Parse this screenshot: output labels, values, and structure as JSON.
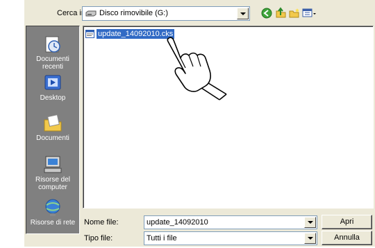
{
  "dialog": {
    "look_in": {
      "label": "Cerca in:",
      "value": "Disco rimovibile (G:)",
      "icon": "removable-drive-icon"
    },
    "toolbar": {
      "back_icon": "back-arrow-icon",
      "up_icon": "up-one-level-icon",
      "new_folder_icon": "new-folder-icon",
      "view_menu_icon": "view-menu-icon"
    },
    "places": [
      {
        "label_line1": "Documenti",
        "label_line2": "recenti",
        "icon": "recent-documents-icon"
      },
      {
        "label_line1": "Desktop",
        "label_line2": "",
        "icon": "desktop-icon"
      },
      {
        "label_line1": "Documenti",
        "label_line2": "",
        "icon": "my-documents-icon"
      },
      {
        "label_line1": "Risorse del",
        "label_line2": "computer",
        "icon": "my-computer-icon"
      },
      {
        "label_line1": "Risorse di rete",
        "label_line2": "",
        "icon": "network-places-icon"
      }
    ],
    "files": [
      {
        "name": "update_14092010.cks",
        "selected": true,
        "icon": "file-icon"
      }
    ],
    "file_name": {
      "label": "Nome file:",
      "value": "update_14092010"
    },
    "file_type": {
      "label": "Tipo file:",
      "value": "Tutti i file"
    },
    "buttons": {
      "open": "Apri",
      "cancel": "Annulla"
    },
    "colors": {
      "dialog_bg": "#ece9d8",
      "places_bg": "#808080",
      "selection": "#316ac5"
    }
  }
}
